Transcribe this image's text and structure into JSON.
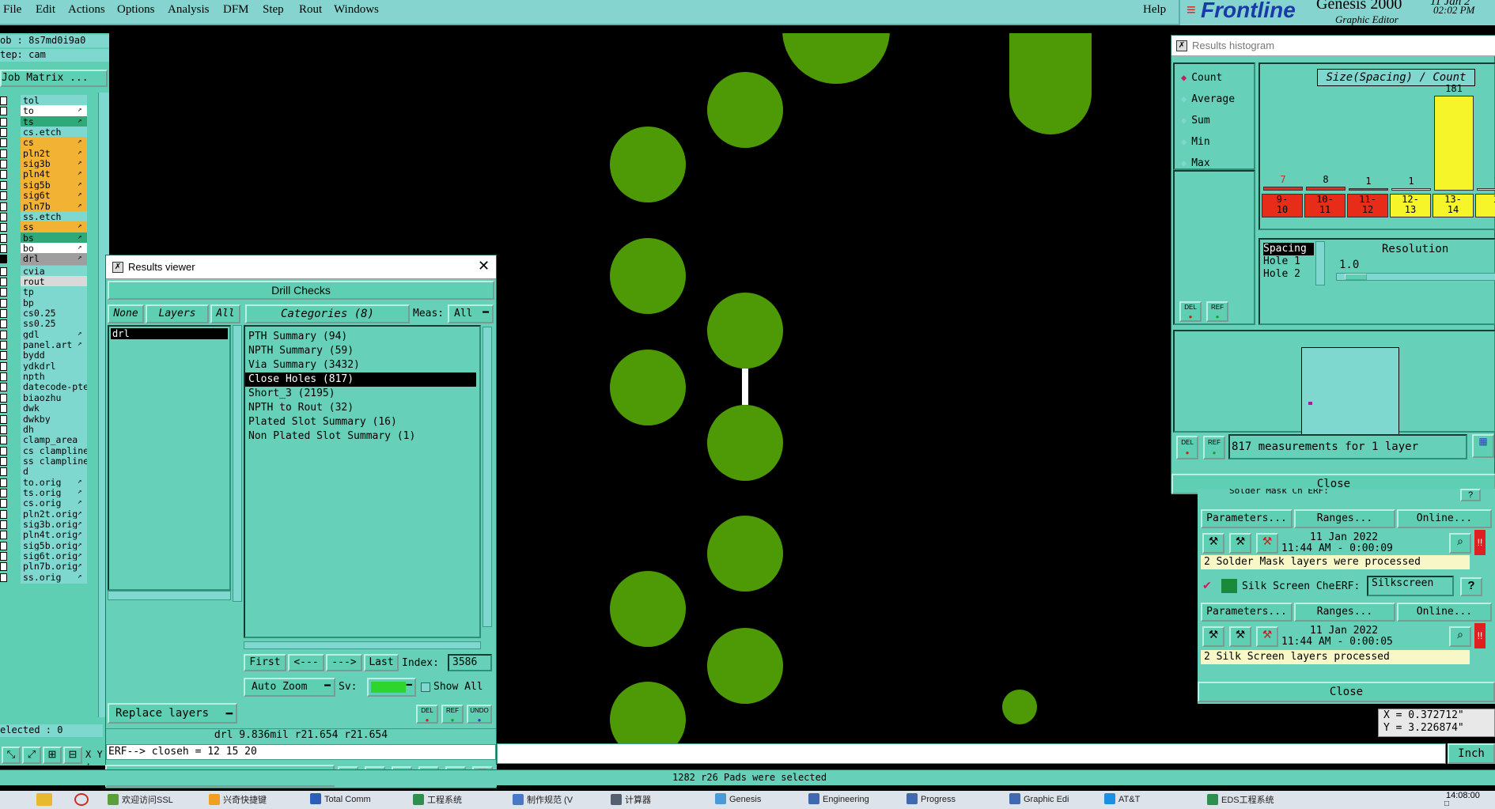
{
  "menubar": {
    "items": [
      "File",
      "Edit",
      "Actions",
      "Options",
      "Analysis",
      "DFM",
      "Step",
      "Rout",
      "Windows"
    ],
    "help": "Help",
    "brand": "Frontline",
    "product": "Genesis 2000",
    "subtitle": "Graphic Editor",
    "date_fragment": "11 Jan 2",
    "time": "02:02 PM"
  },
  "job": {
    "job_line": "ob : 8s7md0i9a0",
    "step_line": "tep: cam",
    "matrix_button": "Job Matrix ..."
  },
  "layers": [
    {
      "name": "tol",
      "color": "#7fd8d0",
      "mark": ""
    },
    {
      "name": "to",
      "color": "#ffffff",
      "mark": "↗"
    },
    {
      "name": "ts",
      "color": "#2fa87a",
      "mark": "↗"
    },
    {
      "name": "cs.etch",
      "color": "#7fd8d0",
      "mark": ""
    },
    {
      "name": "cs",
      "color": "#f2b233",
      "mark": "↗"
    },
    {
      "name": "pln2t",
      "color": "#f2b233",
      "mark": "↗"
    },
    {
      "name": "sig3b",
      "color": "#f2b233",
      "mark": "↗"
    },
    {
      "name": "pln4t",
      "color": "#f2b233",
      "mark": "↗"
    },
    {
      "name": "sig5b",
      "color": "#f2b233",
      "mark": "↗"
    },
    {
      "name": "sig6t",
      "color": "#f2b233",
      "mark": "↗"
    },
    {
      "name": "pln7b",
      "color": "#f2b233",
      "mark": "↗"
    },
    {
      "name": "ss.etch",
      "color": "#7fd8d0",
      "mark": ""
    },
    {
      "name": "ss",
      "color": "#f2b233",
      "mark": "↗"
    },
    {
      "name": "bs",
      "color": "#2fa87a",
      "mark": "↗"
    },
    {
      "name": "bo",
      "color": "#ffffff",
      "mark": "↗"
    },
    {
      "name": "drl",
      "color": "#9e9e9e",
      "mark": "↗"
    },
    {
      "name": "cvia",
      "color": "#7fd8d0",
      "mark": ""
    },
    {
      "name": "rout",
      "color": "#d9d9d9",
      "mark": ""
    },
    {
      "name": "tp",
      "color": "#7fd8d0",
      "mark": ""
    },
    {
      "name": "bp",
      "color": "#7fd8d0",
      "mark": ""
    },
    {
      "name": "cs0.25",
      "color": "#7fd8d0",
      "mark": ""
    },
    {
      "name": "ss0.25",
      "color": "#7fd8d0",
      "mark": ""
    },
    {
      "name": "gdl",
      "color": "#7fd8d0",
      "mark": "↗"
    },
    {
      "name": "panel.art",
      "color": "#7fd8d0",
      "mark": "↗"
    },
    {
      "name": "bydd",
      "color": "#7fd8d0",
      "mark": ""
    },
    {
      "name": "ydkdrl",
      "color": "#7fd8d0",
      "mark": ""
    },
    {
      "name": "npth",
      "color": "#7fd8d0",
      "mark": ""
    },
    {
      "name": "datecode-pte",
      "color": "#7fd8d0",
      "mark": ""
    },
    {
      "name": "biaozhu",
      "color": "#7fd8d0",
      "mark": ""
    },
    {
      "name": "dwk",
      "color": "#7fd8d0",
      "mark": ""
    },
    {
      "name": "dwkby",
      "color": "#7fd8d0",
      "mark": ""
    },
    {
      "name": "dh",
      "color": "#7fd8d0",
      "mark": ""
    },
    {
      "name": "clamp_area",
      "color": "#7fd8d0",
      "mark": ""
    },
    {
      "name": "cs_clampline",
      "color": "#7fd8d0",
      "mark": ""
    },
    {
      "name": "ss_clampline",
      "color": "#7fd8d0",
      "mark": ""
    },
    {
      "name": "d",
      "color": "#7fd8d0",
      "mark": ""
    },
    {
      "name": "to.orig",
      "color": "#7fd8d0",
      "mark": "↗"
    },
    {
      "name": "ts.orig",
      "color": "#7fd8d0",
      "mark": "↗"
    },
    {
      "name": "cs.orig",
      "color": "#7fd8d0",
      "mark": "↗"
    },
    {
      "name": "pln2t.orig",
      "color": "#7fd8d0",
      "mark": "↗"
    },
    {
      "name": "sig3b.orig",
      "color": "#7fd8d0",
      "mark": "↗"
    },
    {
      "name": "pln4t.orig",
      "color": "#7fd8d0",
      "mark": "↗"
    },
    {
      "name": "sig5b.orig",
      "color": "#7fd8d0",
      "mark": "↗"
    },
    {
      "name": "sig6t.orig",
      "color": "#7fd8d0",
      "mark": "↗"
    },
    {
      "name": "pln7b.orig",
      "color": "#7fd8d0",
      "mark": "↗"
    },
    {
      "name": "ss.orig",
      "color": "#7fd8d0",
      "mark": "↗"
    }
  ],
  "selected_line": "elected : 0",
  "xy_label": "X Y :",
  "results_viewer": {
    "title": "Results viewer",
    "header": "Drill Checks",
    "none_btn": "None",
    "layers_btn": "Layers",
    "all_btn": "All",
    "categories_btn": "Categories (8)",
    "meas_label": "Meas:",
    "meas_value": "All",
    "layer_list": [
      "drl"
    ],
    "categories": [
      "PTH Summary (94)",
      "NPTH Summary (59)",
      "Via Summary (3432)",
      "Close Holes (817)",
      "Short_3 (2195)",
      "NPTH to Rout (32)",
      "Plated Slot Summary (16)",
      "Non Plated Slot Summary (1)"
    ],
    "selected_category": "Close Holes (817)",
    "first_btn": "First",
    "prev_btn": "<---",
    "next_btn": "--->",
    "last_btn": "Last",
    "index_label": "Index:",
    "index_value": "3586",
    "zoom_btn": "Auto Zoom",
    "sv_label": "Sv:",
    "show_all": "Show All",
    "replace_btn": "Replace layers",
    "del": "DEL",
    "ref": "REF",
    "undo": "UNDO",
    "info_line": "drl 9.836mil   r21.654   r21.654",
    "erf_line": "ERF--> closeh = 12 15 20",
    "close_btn": "Close"
  },
  "histogram": {
    "title": "Results histogram",
    "modes": [
      "Count",
      "Average",
      "Sum",
      "Min",
      "Max"
    ],
    "selected_mode": "Count",
    "header": "Size(Spacing) / Count",
    "del": "DEL",
    "ref": "REF",
    "bin_labels": [
      [
        "9-",
        "10"
      ],
      [
        "10-",
        "11"
      ],
      [
        "11-",
        "12"
      ],
      [
        "12-",
        "13"
      ],
      [
        "13-",
        "14"
      ],
      [
        "1",
        ""
      ]
    ],
    "bin_counts": [
      7,
      8,
      1,
      1,
      181,
      1
    ],
    "bin_colors": [
      "#e82c1a",
      "#e82c1a",
      "#e82c1a",
      "#f5f52a",
      "#f5f52a",
      "#f5f52a"
    ],
    "count_label_colors": [
      "#c0302a",
      "#000000",
      "#000000",
      "#000000",
      "#000000",
      "#000000"
    ],
    "axis_items": [
      "Spacing",
      "Hole 1",
      "Hole 2"
    ],
    "resolution_label": "Resolution",
    "resolution_value": "1.0",
    "measurements": "817 measurements for 1 layer",
    "close_btn": "Close"
  },
  "checks_panel": {
    "top_label": "Solder Mask Ch ERF:",
    "row1": {
      "parameters": "Parameters...",
      "ranges": "Ranges...",
      "online": "Online..."
    },
    "row1_date": "11 Jan 2022",
    "row1_time": "11:44 AM - 0:00:09",
    "row1_status": "2 Solder Mask layers were processed",
    "silk_label": "Silk Screen Che",
    "erf_label": "ERF:",
    "erf_value": "Silkscreen",
    "help": "?",
    "row2": {
      "parameters": "Parameters...",
      "ranges": "Ranges...",
      "online": "Online..."
    },
    "row2_date": "11 Jan 2022",
    "row2_time": "11:44 AM - 0:00:05",
    "row2_status": "2 Silk Screen layers processed",
    "close_btn": "Close"
  },
  "coords": {
    "x": "X = 0.372712\"",
    "y": "Y = 3.226874\""
  },
  "units_btn": "Inch",
  "status_message": "1282 r26 Pads were selected",
  "taskbar": {
    "items": [
      {
        "label": "欢迎访问SSL",
        "color": "#5a9f3a"
      },
      {
        "label": "兴奇快捷键",
        "color": "#f0a020"
      },
      {
        "label": "Total Comm",
        "color": "#2b5fb8"
      },
      {
        "label": "工程系统",
        "color": "#2f8f4f"
      },
      {
        "label": "制作规范 (V",
        "color": "#4a78c8"
      },
      {
        "label": "计算器",
        "color": "#556070"
      },
      {
        "label": "Genesis",
        "color": "#4a9ad8"
      },
      {
        "label": "Engineering",
        "color": "#3f6ab0"
      },
      {
        "label": "Progress",
        "color": "#3f6ab0"
      },
      {
        "label": "Graphic Edi",
        "color": "#3f6ab0"
      },
      {
        "label": "AT&T",
        "color": "#1d8fe0"
      },
      {
        "label": "EDS工程系统",
        "color": "#2f8f4f"
      }
    ],
    "clock": "14:08:00"
  },
  "pad_color": "#4e9a06"
}
